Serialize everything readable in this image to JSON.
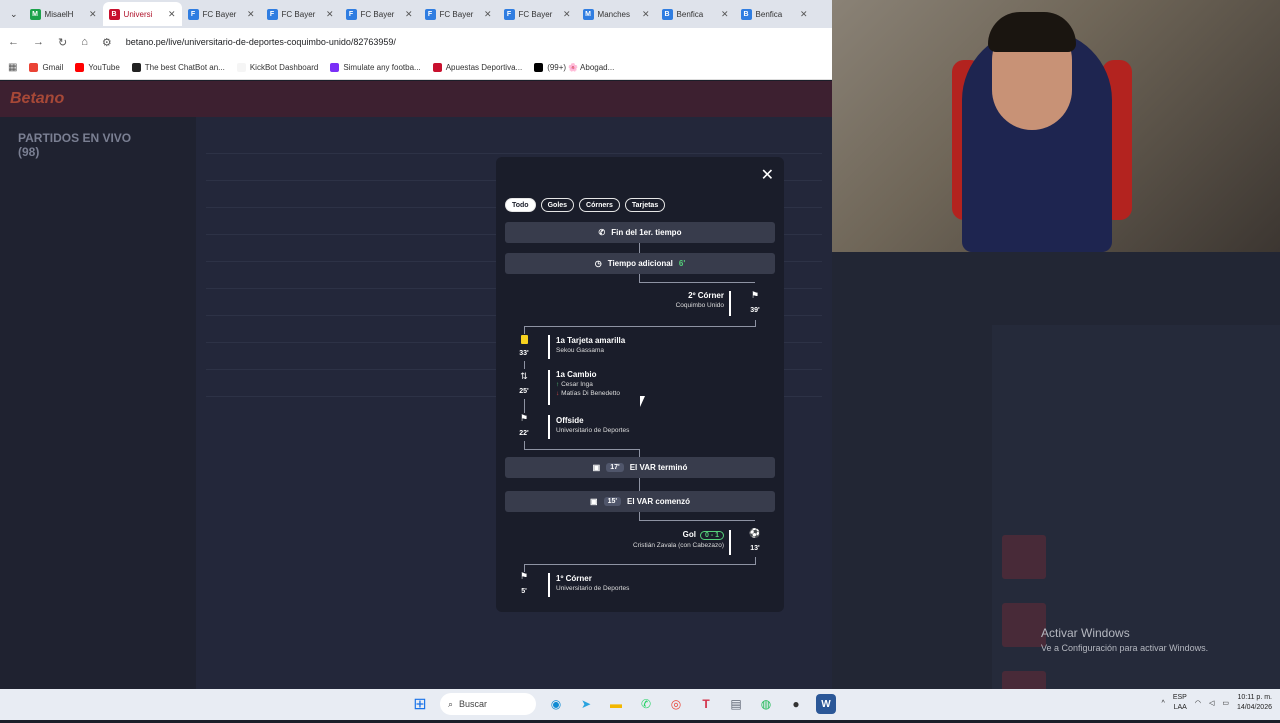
{
  "browser": {
    "tabs": [
      {
        "label": "MisaelH",
        "color": "#1ba24a",
        "letter": "M",
        "active": false
      },
      {
        "label": "Universi",
        "color": "#c8102e",
        "letter": "B",
        "active": true
      },
      {
        "label": "FC Bayer",
        "color": "#2f7de1",
        "letter": "F",
        "active": false
      },
      {
        "label": "FC Bayer",
        "color": "#2f7de1",
        "letter": "F",
        "active": false
      },
      {
        "label": "FC Bayer",
        "color": "#2f7de1",
        "letter": "F",
        "active": false
      },
      {
        "label": "FC Bayer",
        "color": "#2f7de1",
        "letter": "F",
        "active": false
      },
      {
        "label": "FC Bayer",
        "color": "#2f7de1",
        "letter": "F",
        "active": false
      },
      {
        "label": "Manches",
        "color": "#2f7de1",
        "letter": "M",
        "active": false
      },
      {
        "label": "Benfica",
        "color": "#2f7de1",
        "letter": "B",
        "active": false
      },
      {
        "label": "Benfica",
        "color": "#2f7de1",
        "letter": "B",
        "active": false
      }
    ],
    "url": "betano.pe/live/universitario-de-deportes-coquimbo-unido/82763959/",
    "bookmarks": [
      {
        "label": "Gmail",
        "color": "#ea4335"
      },
      {
        "label": "YouTube",
        "color": "#ff0000"
      },
      {
        "label": "The best ChatBot an...",
        "color": "#222222"
      },
      {
        "label": "KickBot Dashboard",
        "color": "#f5f5f5"
      },
      {
        "label": "Simulate any footba...",
        "color": "#7b2ff7"
      },
      {
        "label": "Apuestas Deportiva...",
        "color": "#c8102e"
      },
      {
        "label": "(99+) 🌸 Abogad...",
        "color": "#000000"
      }
    ]
  },
  "site": {
    "logo": "Betano",
    "sidebar_title": "PARTIDOS EN VIVO",
    "sidebar_count": "(98)"
  },
  "modal": {
    "filters": [
      "Todo",
      "Goles",
      "Córners",
      "Tarjetas"
    ],
    "bars": {
      "half_time": "Fin del 1er. tiempo",
      "added_time_label": "Tiempo adicional",
      "added_time_value": "6'",
      "var_end_min": "17'",
      "var_end_label": "El VAR terminó",
      "var_start_min": "15'",
      "var_start_label": "El VAR comenzó"
    },
    "events": {
      "corner2": {
        "title": "2º Córner",
        "team": "Coquimbo Unido",
        "minute": "39'"
      },
      "yellow": {
        "title": "1a Tarjeta amarilla",
        "player": "Sekou Gassama",
        "minute": "33'"
      },
      "sub": {
        "title": "1a Cambio",
        "in": "Cesar Inga",
        "out": "Matías Di Benedetto",
        "minute": "25'"
      },
      "offside": {
        "title": "Offside",
        "team": "Universitario de Deportes",
        "minute": "22'"
      },
      "goal": {
        "title": "Gol",
        "score": "0 - 1",
        "player": "Cristián Zavala (con Cabezazo)",
        "minute": "13'"
      },
      "corner1": {
        "title": "1º Córner",
        "team": "Universitario de Deportes",
        "minute": "5'"
      }
    }
  },
  "windows": {
    "activate_title": "Activar Windows",
    "activate_sub": "Ve a Configuración para activar Windows.",
    "search_placeholder": "Buscar",
    "lang": "ESP",
    "region": "LAA",
    "time": "10:11 p. m.",
    "date": "14/04/2026"
  }
}
